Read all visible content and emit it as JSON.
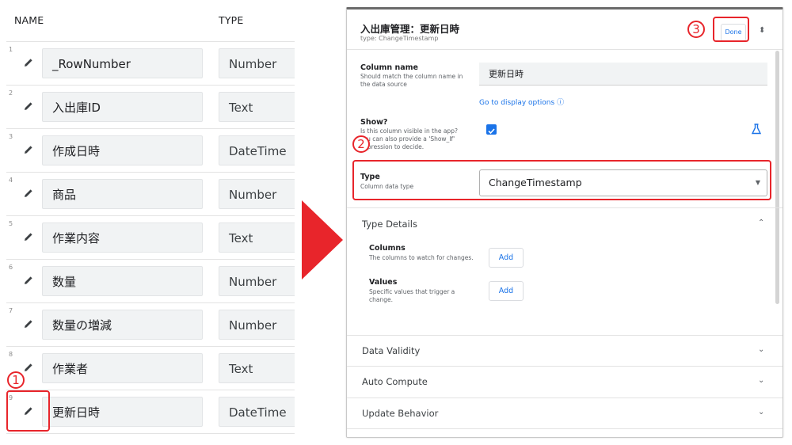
{
  "left": {
    "header_name": "NAME",
    "header_type": "TYPE",
    "rows": [
      {
        "num": "1",
        "name": "_RowNumber",
        "type": "Number"
      },
      {
        "num": "2",
        "name": "入出庫ID",
        "type": "Text"
      },
      {
        "num": "3",
        "name": "作成日時",
        "type": "DateTime"
      },
      {
        "num": "4",
        "name": "商品",
        "type": "Number"
      },
      {
        "num": "5",
        "name": "作業内容",
        "type": "Text"
      },
      {
        "num": "6",
        "name": "数量",
        "type": "Number"
      },
      {
        "num": "7",
        "name": "数量の増減",
        "type": "Number"
      },
      {
        "num": "8",
        "name": "作業者",
        "type": "Text"
      },
      {
        "num": "9",
        "name": "更新日時",
        "type": "DateTime"
      }
    ]
  },
  "annotations": {
    "step1": "1",
    "step2": "2",
    "step3": "3",
    "color": "#e8252b"
  },
  "panel": {
    "title": "入出庫管理：更新日時",
    "subtitle": "type: ChangeTimestamp",
    "done_label": "Done",
    "updown_icon": "unfold-icon",
    "column_name": {
      "label": "Column name",
      "help": "Should match the column name in the data source",
      "value": "更新日時"
    },
    "display_link": "Go to display options ⓘ",
    "show": {
      "label": "Show?",
      "help": "Is this column visible in the app? You can also provide a 'Show_If' expression to decide.",
      "checked": true
    },
    "type": {
      "label": "Type",
      "help": "Column data type",
      "value": "ChangeTimestamp"
    },
    "type_details": {
      "title": "Type Details",
      "columns_label": "Columns",
      "columns_help": "The columns to watch for changes.",
      "columns_add": "Add",
      "values_label": "Values",
      "values_help": "Specific values that trigger a change.",
      "values_add": "Add"
    },
    "sections": [
      "Data Validity",
      "Auto Compute",
      "Update Behavior"
    ]
  }
}
